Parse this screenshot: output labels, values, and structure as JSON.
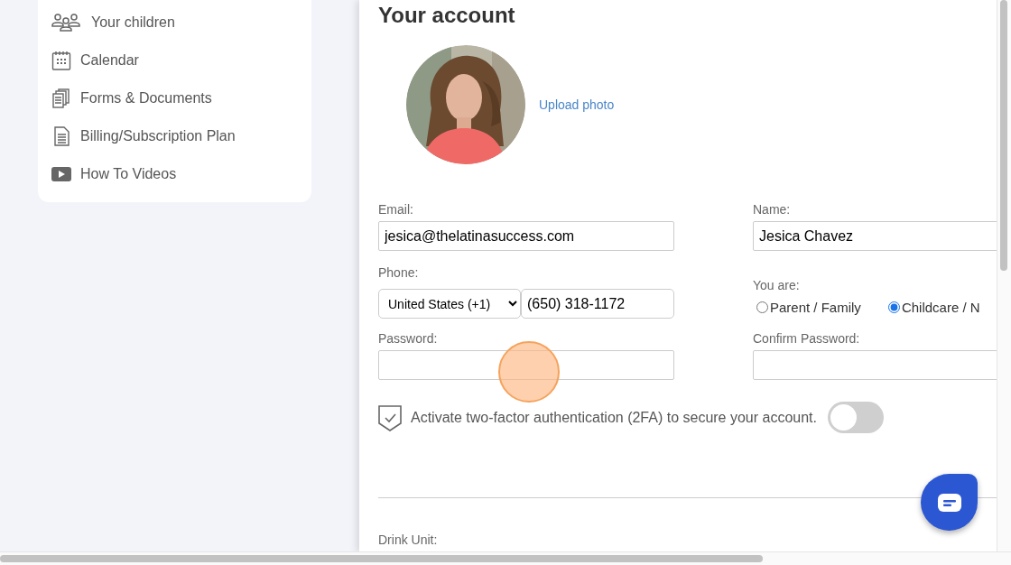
{
  "sidebar": {
    "items": [
      {
        "label": "Your children"
      },
      {
        "label": "Calendar"
      },
      {
        "label": "Forms & Documents"
      },
      {
        "label": "Billing/Subscription Plan"
      },
      {
        "label": "How To Videos"
      }
    ]
  },
  "account": {
    "title": "Your account",
    "upload_link": "Upload photo",
    "email": {
      "label": "Email:",
      "value": "jesica@thelatinasuccess.com"
    },
    "name": {
      "label": "Name:",
      "value": "Jesica Chavez"
    },
    "phone": {
      "label": "Phone:",
      "country": "United States (+1)",
      "value": "(650) 318-1172"
    },
    "role": {
      "label": "You are:",
      "options": [
        {
          "label": "Parent / Family",
          "selected": false
        },
        {
          "label": "Childcare / N",
          "selected": true
        }
      ]
    },
    "password": {
      "label": "Password:"
    },
    "confirm_password": {
      "label": "Confirm Password:"
    },
    "two_factor": {
      "text": "Activate two-factor authentication (2FA) to secure your account.",
      "on": false
    },
    "next_section": {
      "label": "Drink Unit:"
    }
  }
}
